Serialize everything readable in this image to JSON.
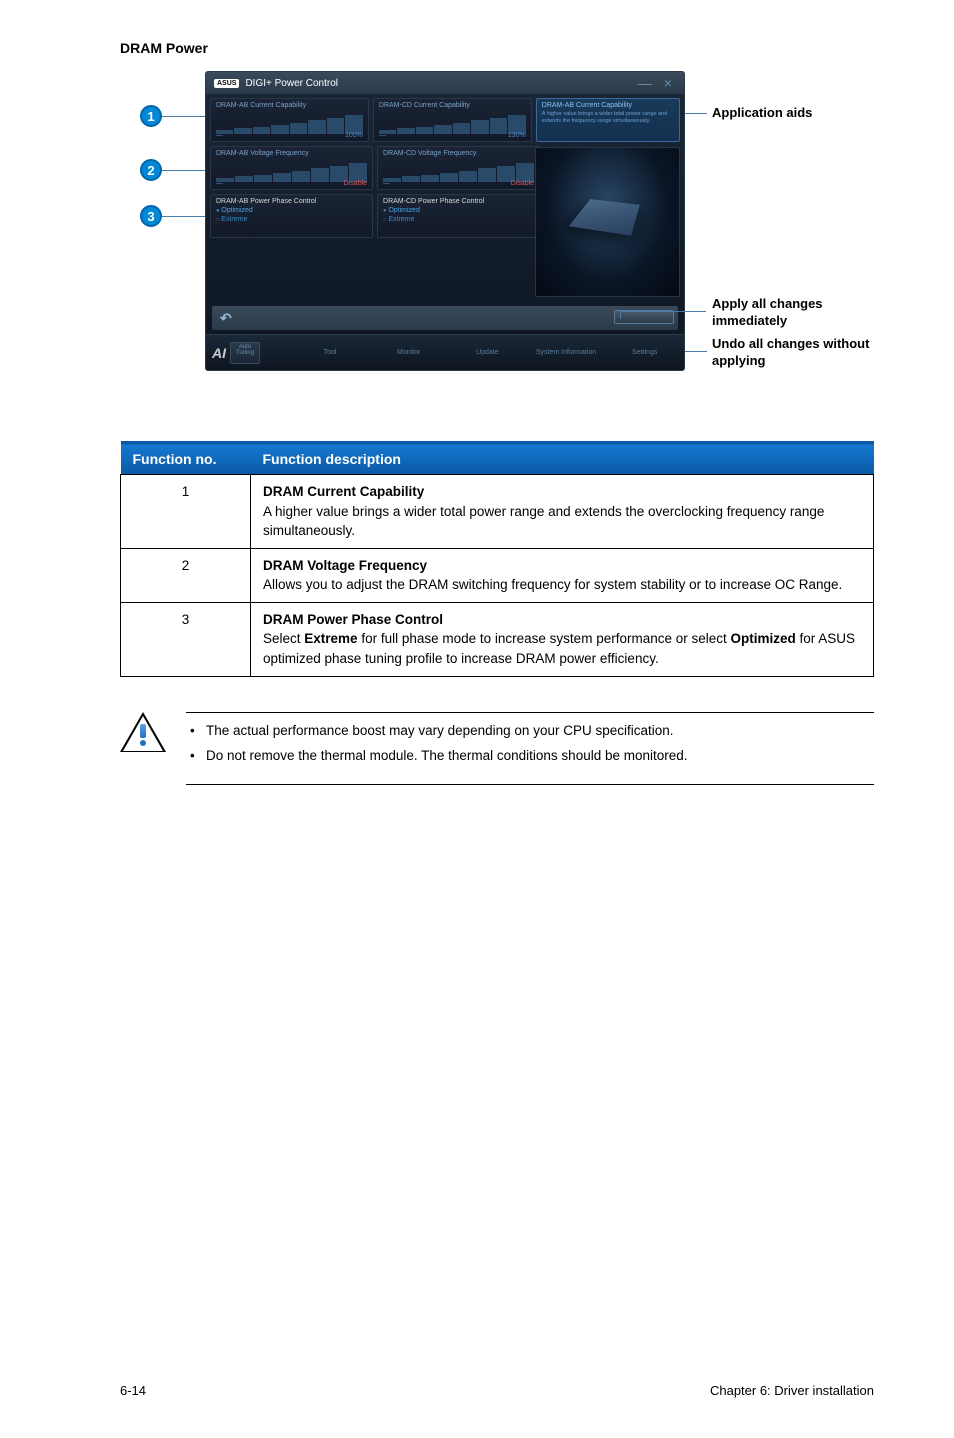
{
  "section_title": "DRAM Power",
  "badges": [
    "1",
    "2",
    "3"
  ],
  "window": {
    "logo": "ASUS",
    "title": "DIGI+ Power Control",
    "close": "—   ×"
  },
  "panels": {
    "r1a_title": "DRAM-AB Current Capability",
    "r1a_val": "100%",
    "r1b_title": "DRAM-CD Current Capability",
    "r1b_val": "130%",
    "info_title": "DRAM-AB Current Capability",
    "info_text": "A higher value brings a wider total power range and extends the frequency range simultaneously.",
    "r2a_title": "DRAM-AB Voltage Frequency",
    "r2a_left": "—",
    "r2a_right": "Disable",
    "r2b_title": "DRAM-CD Voltage Frequency",
    "r2b_left": "—",
    "r2b_right": "Disable",
    "r3a_title": "DRAM-AB Power Phase Control",
    "r3b_title": "DRAM-CD Power Phase Control",
    "opt1": "Optimized",
    "opt2": "Extreme"
  },
  "bottom_bar": {
    "undo": "↶"
  },
  "nav": {
    "ai": "AI",
    "sub_label": "Auto Tuning",
    "items": [
      "Tool",
      "Monitor",
      "Update",
      "System Information",
      "Settings"
    ]
  },
  "callouts": {
    "aids": "Application aids",
    "apply": "Apply all changes immediately",
    "undo": "Undo all changes without applying"
  },
  "table": {
    "h1": "Function no.",
    "h2": "Function description",
    "rows": [
      {
        "no": "1",
        "title": "DRAM Current Capability",
        "desc": "A higher value brings a wider total power range and extends the overclocking frequency range simultaneously."
      },
      {
        "no": "2",
        "title": "DRAM Voltage Frequency",
        "desc": "Allows you to adjust the DRAM switching frequency for system stability or to increase OC Range."
      },
      {
        "no": "3",
        "title": "DRAM Power Phase Control",
        "desc_pre": "Select ",
        "bold1": "Extreme",
        "desc_mid": " for full phase mode to increase system performance or select ",
        "bold2": "Optimized",
        "desc_post": " for ASUS optimized phase tuning profile to increase DRAM power efficiency."
      }
    ]
  },
  "notice": {
    "b1": "The actual performance boost may vary depending on your CPU specification.",
    "b2": "Do not remove the thermal module. The thermal conditions should be monitored."
  },
  "footer": {
    "page": "6-14",
    "chapter": "Chapter 6: Driver installation"
  }
}
